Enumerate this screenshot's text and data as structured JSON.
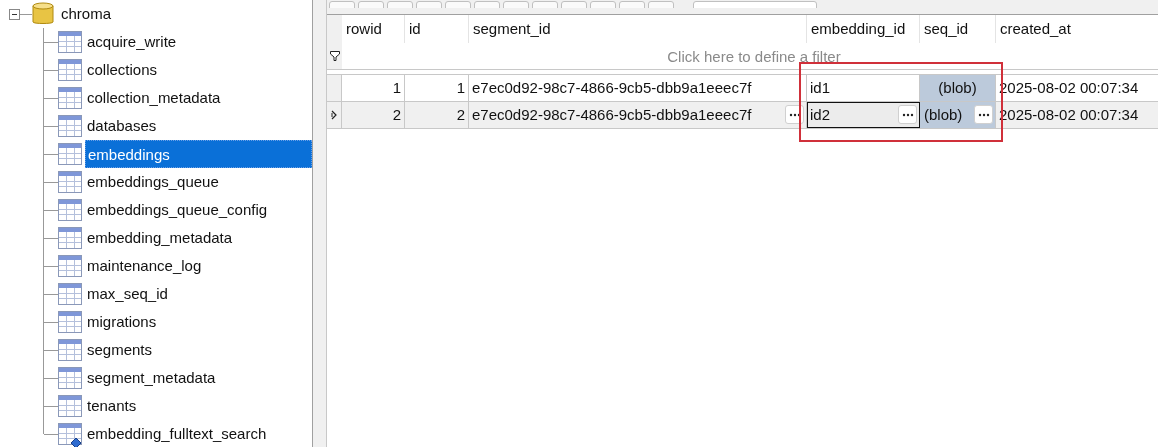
{
  "tree": {
    "root": {
      "label": "chroma",
      "expanded": true
    },
    "items": [
      {
        "label": "acquire_write",
        "kind": "table",
        "selected": false
      },
      {
        "label": "collections",
        "kind": "table",
        "selected": false
      },
      {
        "label": "collection_metadata",
        "kind": "table",
        "selected": false
      },
      {
        "label": "databases",
        "kind": "table",
        "selected": false
      },
      {
        "label": "embeddings",
        "kind": "table",
        "selected": true
      },
      {
        "label": "embeddings_queue",
        "kind": "table",
        "selected": false
      },
      {
        "label": "embeddings_queue_config",
        "kind": "table",
        "selected": false
      },
      {
        "label": "embedding_metadata",
        "kind": "table",
        "selected": false
      },
      {
        "label": "maintenance_log",
        "kind": "table",
        "selected": false
      },
      {
        "label": "max_seq_id",
        "kind": "table",
        "selected": false
      },
      {
        "label": "migrations",
        "kind": "table",
        "selected": false
      },
      {
        "label": "segments",
        "kind": "table",
        "selected": false
      },
      {
        "label": "segment_metadata",
        "kind": "table",
        "selected": false
      },
      {
        "label": "tenants",
        "kind": "table",
        "selected": false
      },
      {
        "label": "embedding_fulltext_search",
        "kind": "virtual",
        "selected": false
      }
    ]
  },
  "grid": {
    "columns": [
      {
        "label": "rowid",
        "kind": "integer"
      },
      {
        "label": "id",
        "kind": "integer"
      },
      {
        "label": "segment_id",
        "kind": "text"
      },
      {
        "label": "embedding_id",
        "kind": "text"
      },
      {
        "label": "seq_id",
        "kind": "blob"
      },
      {
        "label": "created_at",
        "kind": "datetime"
      }
    ],
    "filter_hint": "Click here to define a filter",
    "rows": [
      {
        "current": false,
        "cells": [
          {
            "text": "1",
            "focused": false
          },
          {
            "text": "1",
            "focused": false
          },
          {
            "text": "e7ec0d92-98c7-4866-9cb5-dbb9a1eeec7f",
            "focused": false
          },
          {
            "text": "id1",
            "focused": false
          },
          {
            "text": "(blob)",
            "focused": false
          },
          {
            "text": "2025-08-02 00:07:34",
            "focused": false
          }
        ]
      },
      {
        "current": true,
        "cells": [
          {
            "text": "2",
            "focused": false
          },
          {
            "text": "2",
            "focused": false
          },
          {
            "text": "e7ec0d92-98c7-4866-9cb5-dbb9a1eeec7f",
            "focused": false
          },
          {
            "text": "id2",
            "focused": true
          },
          {
            "text": "(blob)",
            "focused": false
          },
          {
            "text": "2025-08-02 00:07:34",
            "focused": false
          }
        ]
      }
    ]
  }
}
